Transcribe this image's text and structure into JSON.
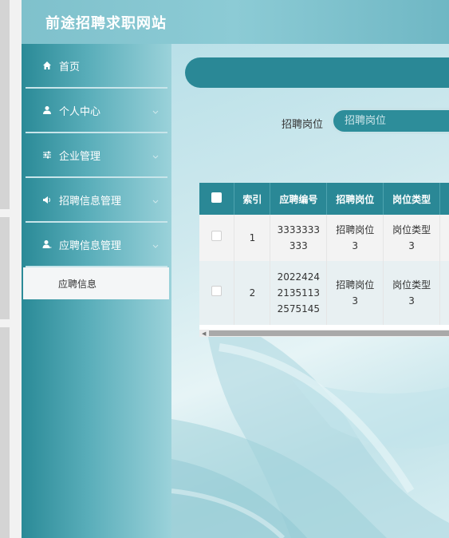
{
  "header": {
    "title": "前途招聘求职网站"
  },
  "sidebar": {
    "items": [
      {
        "label": "首页",
        "icon": "home-icon"
      },
      {
        "label": "个人中心",
        "icon": "user-icon"
      },
      {
        "label": "企业管理",
        "icon": "sliders-icon"
      },
      {
        "label": "招聘信息管理",
        "icon": "megaphone-icon"
      },
      {
        "label": "应聘信息管理",
        "icon": "user-edit-icon"
      }
    ],
    "submenu": {
      "label": "应聘信息"
    }
  },
  "search": {
    "label": "招聘岗位",
    "placeholder": "招聘岗位"
  },
  "table": {
    "headers": [
      "索引",
      "应聘编号",
      "招聘岗位",
      "岗位类型"
    ],
    "rows": [
      {
        "index": "1",
        "app_no_lines": [
          "3333333",
          "333"
        ],
        "position_lines": [
          "招聘岗位",
          "3"
        ],
        "type_lines": [
          "岗位类型",
          "3"
        ]
      },
      {
        "index": "2",
        "app_no_lines": [
          "2022424",
          "2135113",
          "2575145"
        ],
        "position_lines": [
          "招聘岗位",
          "3"
        ],
        "type_lines": [
          "岗位类型",
          "3"
        ]
      }
    ]
  },
  "colors": {
    "accent": "#2a8896",
    "header": "#8ccbd5"
  }
}
